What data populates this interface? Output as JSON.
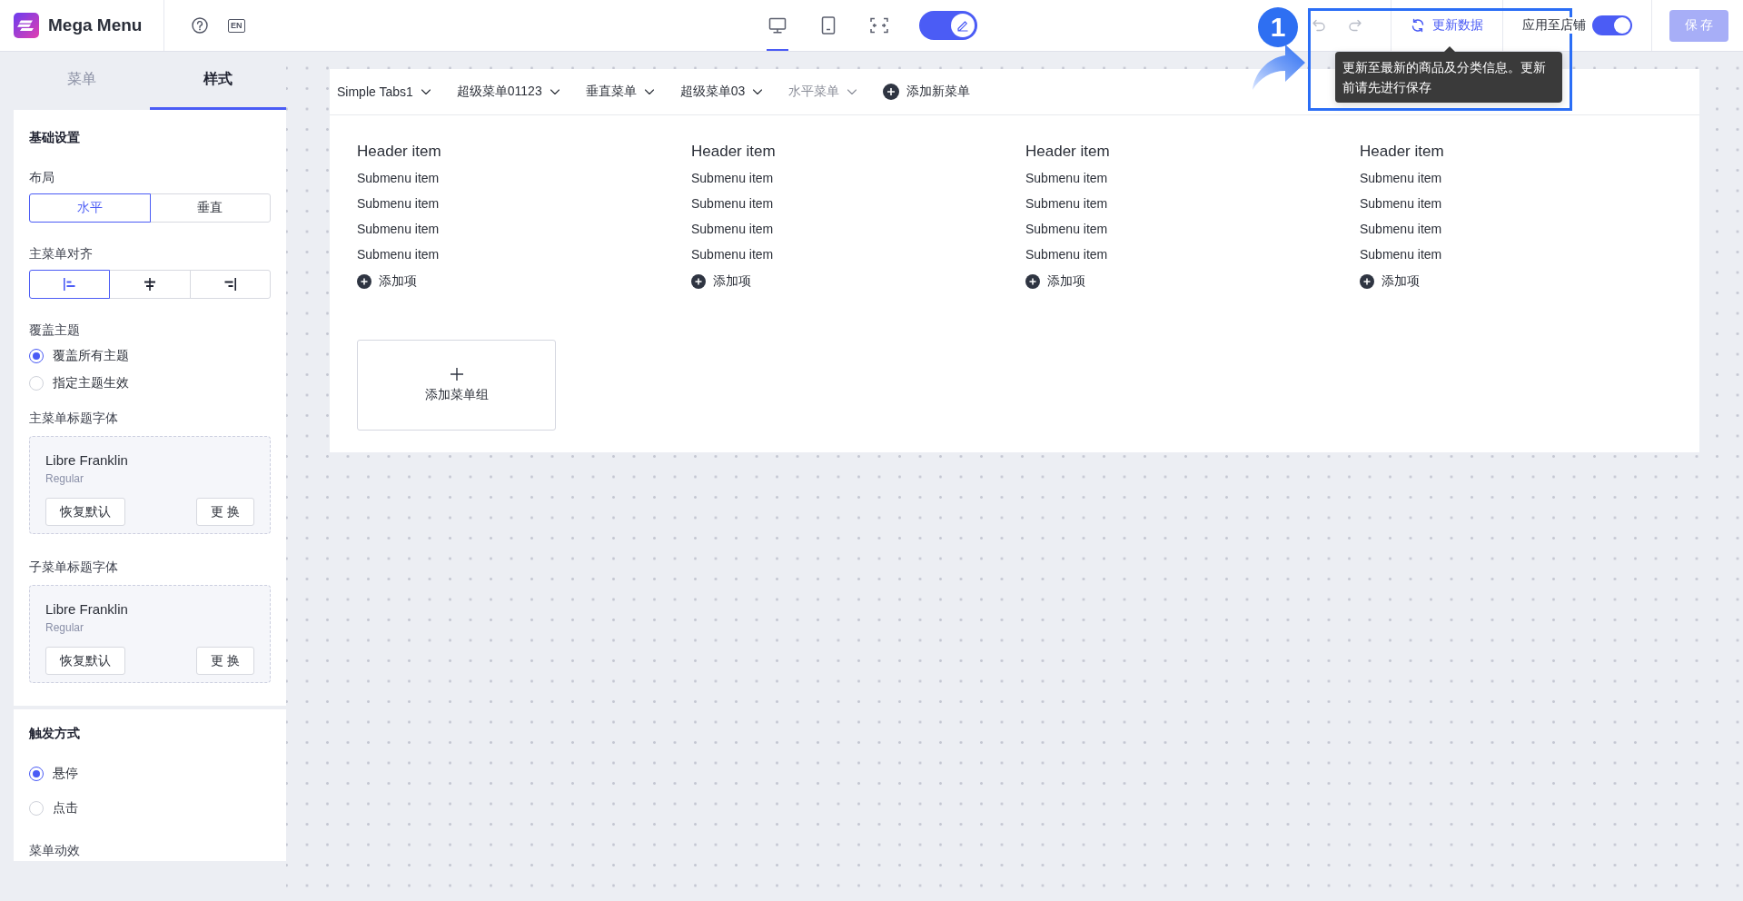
{
  "app": {
    "title": "Mega Menu",
    "language": "EN"
  },
  "toolbar": {
    "devices": [
      {
        "kind": "desktop",
        "selected": true
      },
      {
        "kind": "tablet",
        "selected": false
      },
      {
        "kind": "fit-width",
        "selected": false
      }
    ],
    "edit_mode": {
      "on": true
    },
    "undo": {
      "disabled": true
    },
    "redo": {
      "disabled": true
    },
    "update": {
      "label": "更新数据"
    },
    "apply_to_store": {
      "label": "应用至店铺",
      "on": true
    },
    "save": {
      "label": "保 存",
      "disabled": true
    }
  },
  "tooltip": {
    "text": "更新至最新的商品及分类信息。更新前请先进行保存"
  },
  "annotation": {
    "step": "1"
  },
  "sidebar": {
    "tabs": [
      {
        "label": "菜单",
        "selected": false
      },
      {
        "label": "样式",
        "selected": true
      }
    ],
    "panels": [
      {
        "title": "基础设置",
        "fields": [
          {
            "kind": "segmented",
            "label": "布局",
            "options": [
              {
                "label": "水平",
                "selected": true
              },
              {
                "label": "垂直",
                "selected": false
              }
            ]
          },
          {
            "kind": "align",
            "label": "主菜单对齐",
            "options": [
              {
                "kind": "left",
                "selected": true
              },
              {
                "kind": "center",
                "selected": false
              },
              {
                "kind": "right",
                "selected": false
              }
            ]
          },
          {
            "kind": "radio",
            "label": "覆盖主题",
            "options": [
              {
                "label": "覆盖所有主题",
                "selected": true
              },
              {
                "label": "指定主题生效",
                "selected": false
              }
            ]
          },
          {
            "kind": "font",
            "label": "主菜单标题字体",
            "font": "Libre Franklin",
            "style": "Regular",
            "buttons": [
              "恢复默认",
              "更 换"
            ]
          },
          {
            "kind": "font",
            "label": "子菜单标题字体",
            "font": "Libre Franklin",
            "style": "Regular",
            "buttons": [
              "恢复默认",
              "更 换"
            ]
          }
        ]
      },
      {
        "title": "触发方式",
        "fields": [
          {
            "kind": "radio",
            "options": [
              {
                "label": "悬停",
                "selected": true
              },
              {
                "label": "点击",
                "selected": false
              }
            ]
          },
          {
            "kind": "label",
            "label": "菜单动效"
          }
        ]
      }
    ]
  },
  "preview": {
    "menu_tabs": [
      {
        "label": "Simple Tabs1",
        "selected": false
      },
      {
        "label": "超级菜单01123",
        "selected": false
      },
      {
        "label": "垂直菜单",
        "selected": false
      },
      {
        "label": "超级菜单03",
        "selected": false
      },
      {
        "label": "水平菜单",
        "selected": true
      }
    ],
    "add_menu": "添加新菜单",
    "columns": [
      {
        "header": "Header item",
        "items": [
          "Submenu item",
          "Submenu item",
          "Submenu item",
          "Submenu item"
        ],
        "add_item": "添加项"
      },
      {
        "header": "Header item",
        "items": [
          "Submenu item",
          "Submenu item",
          "Submenu item",
          "Submenu item"
        ],
        "add_item": "添加项"
      },
      {
        "header": "Header item",
        "items": [
          "Submenu item",
          "Submenu item",
          "Submenu item",
          "Submenu item"
        ],
        "add_item": "添加项"
      },
      {
        "header": "Header item",
        "items": [
          "Submenu item",
          "Submenu item",
          "Submenu item",
          "Submenu item"
        ],
        "add_item": "添加项"
      }
    ],
    "add_group": "添加菜单组"
  }
}
